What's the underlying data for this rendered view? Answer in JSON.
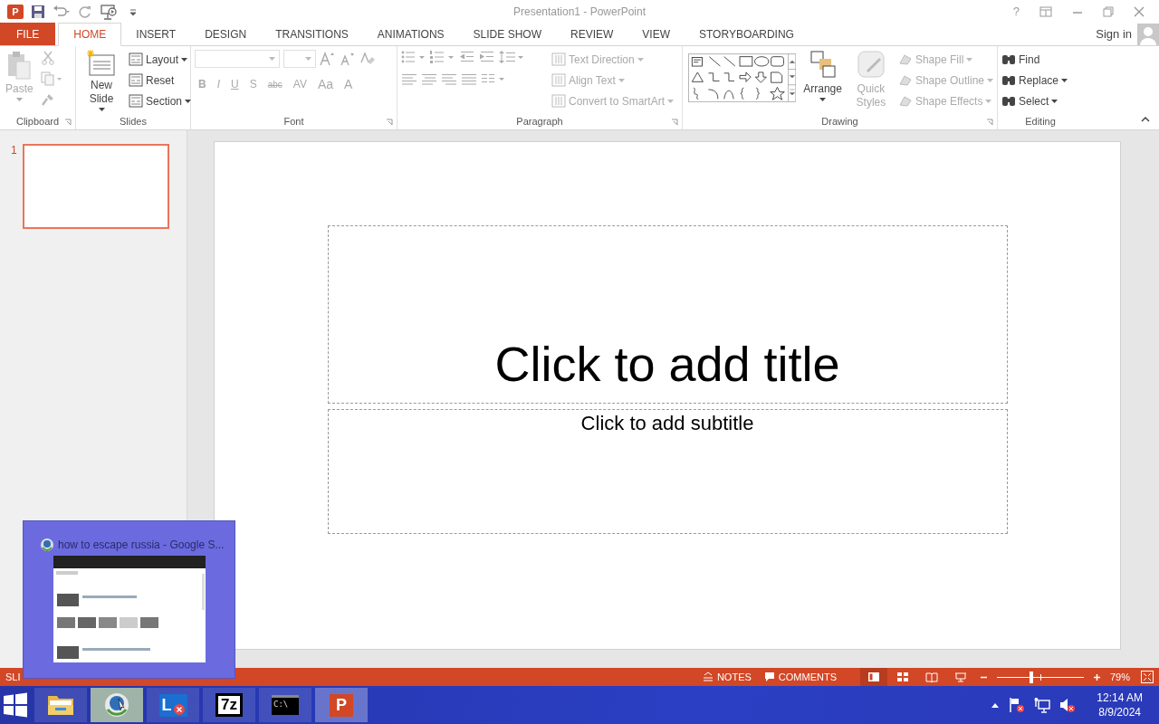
{
  "window": {
    "logo": "P",
    "title": "Presentation1 - PowerPoint",
    "help": "?",
    "sign_in": "Sign in"
  },
  "tabs": [
    {
      "label": "FILE",
      "kind": "file",
      "selected": false
    },
    {
      "label": "HOME",
      "kind": "tab",
      "selected": true
    },
    {
      "label": "INSERT",
      "kind": "tab",
      "selected": false
    },
    {
      "label": "DESIGN",
      "kind": "tab",
      "selected": false
    },
    {
      "label": "TRANSITIONS",
      "kind": "tab",
      "selected": false
    },
    {
      "label": "ANIMATIONS",
      "kind": "tab",
      "selected": false
    },
    {
      "label": "SLIDE SHOW",
      "kind": "tab",
      "selected": false
    },
    {
      "label": "REVIEW",
      "kind": "tab",
      "selected": false
    },
    {
      "label": "VIEW",
      "kind": "tab",
      "selected": false
    },
    {
      "label": "STORYBOARDING",
      "kind": "tab",
      "selected": false
    }
  ],
  "ribbon": {
    "clipboard": {
      "label": "Clipboard",
      "paste": {
        "label": "Paste",
        "disabled": true
      }
    },
    "slides": {
      "label": "Slides",
      "new_slide": "New Slide",
      "items": [
        {
          "label": "Layout",
          "dropdown": true
        },
        {
          "label": "Reset",
          "dropdown": false
        },
        {
          "label": "Section",
          "dropdown": true
        }
      ]
    },
    "font": {
      "label": "Font",
      "disabled": true,
      "format_buttons": [
        {
          "label": "B"
        },
        {
          "label": "I"
        },
        {
          "label": "U"
        },
        {
          "label": "S"
        },
        {
          "label": "abc"
        },
        {
          "label": "AV"
        },
        {
          "label": "Aa"
        },
        {
          "label": "A"
        }
      ]
    },
    "paragraph": {
      "label": "Paragraph",
      "disabled": true,
      "items": [
        {
          "label": "Text Direction"
        },
        {
          "label": "Align Text"
        },
        {
          "label": "Convert to SmartArt"
        }
      ]
    },
    "drawing": {
      "label": "Drawing",
      "arrange": "Arrange",
      "quick_styles": {
        "label": "Quick Styles",
        "disabled": true
      },
      "items": [
        {
          "label": "Shape Fill",
          "disabled": true
        },
        {
          "label": "Shape Outline",
          "disabled": true
        },
        {
          "label": "Shape Effects",
          "disabled": true
        }
      ]
    },
    "editing": {
      "label": "Editing",
      "items": [
        {
          "label": "Find"
        },
        {
          "label": "Replace"
        },
        {
          "label": "Select"
        }
      ]
    }
  },
  "slides_panel": [
    {
      "number": "1",
      "selected": true
    }
  ],
  "slide": {
    "title_placeholder": "Click to add title",
    "subtitle_placeholder": "Click to add subtitle"
  },
  "taskbar_preview": {
    "title": "how to escape russia - Google S..."
  },
  "status_bar": {
    "slide_info": "SLI",
    "notes": "NOTES",
    "comments": "COMMENTS",
    "views": [
      {
        "kind": "normal",
        "selected": true
      },
      {
        "kind": "sorter",
        "selected": false
      },
      {
        "kind": "reading",
        "selected": false
      },
      {
        "kind": "show",
        "selected": false
      }
    ],
    "zoom": {
      "level": 0.38,
      "reading": "79%"
    }
  },
  "taskbar": {
    "apps": [
      {
        "kind": "explorer",
        "active": false,
        "hovered": false
      },
      {
        "kind": "browser",
        "active": false,
        "hovered": true
      },
      {
        "kind": "lync",
        "glyph": "L",
        "active": false,
        "hovered": false
      },
      {
        "kind": "archiver",
        "glyph": "7z",
        "active": false,
        "hovered": false
      },
      {
        "kind": "console",
        "glyph": "C:\\",
        "active": false,
        "hovered": false
      },
      {
        "kind": "powerpoint",
        "glyph": "P",
        "active": true,
        "hovered": false
      }
    ],
    "time": "12:14 AM",
    "date": "8/9/2024"
  }
}
